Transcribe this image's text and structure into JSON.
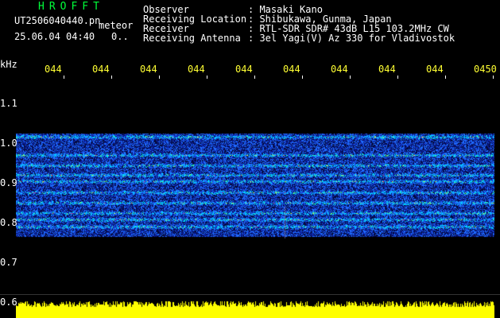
{
  "header": {
    "station_code": "HROFFT",
    "filename": "UT2506040440.pn",
    "type_label": "meteor",
    "datetime": "25.06.04 04:40",
    "extra": "0..",
    "fields": [
      {
        "label": "Observer",
        "value": ": Masaki Kano"
      },
      {
        "label": "Receiving Location",
        "value": ": Shibukawa, Gunma, Japan"
      },
      {
        "label": "Receiver",
        "value": ": RTL-SDR SDR# 43dB L15 103.2MHz CW"
      },
      {
        "label": "Receiving Antenna",
        "value": ": 3el Yagi(V) Az 330 for Vladivostok"
      }
    ]
  },
  "axes": {
    "unit_label": "kHz",
    "x_ticks": [
      "044",
      "044",
      "044",
      "044",
      "044",
      "044",
      "044",
      "044",
      "044",
      "0450"
    ],
    "y_ticks": [
      "1.1",
      "1.0",
      "0.9",
      "0.8",
      "0.7",
      "0.6"
    ]
  },
  "colors": {
    "background": "#000000",
    "text": "#ffffff",
    "station_code": "#00ff3a",
    "tick_labels": "#ffff33",
    "signal_bar": "#ffff00",
    "noise_low": "#0b1fa0",
    "noise_mid": "#1f6bff",
    "noise_high": "#00d8ff",
    "hot": "#ff4040"
  }
}
